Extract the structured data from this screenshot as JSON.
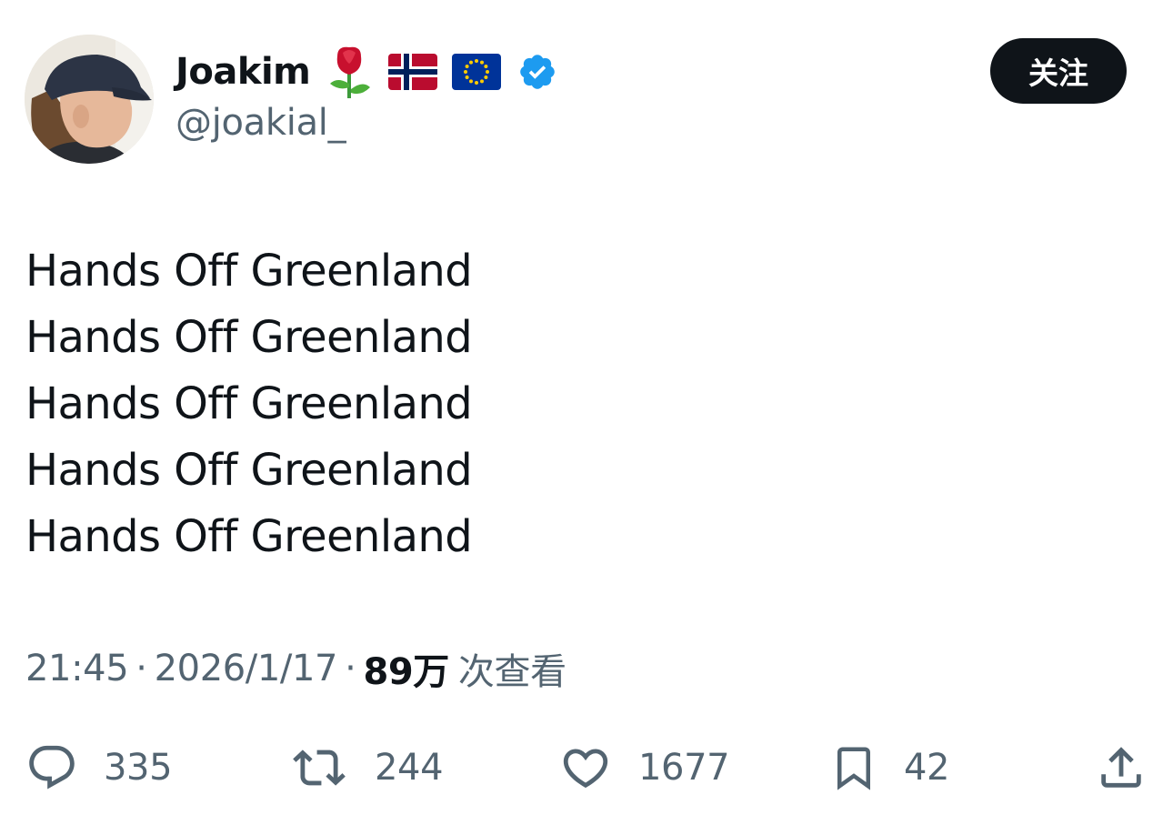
{
  "user": {
    "display_name": "Joakim",
    "handle": "@joakial_",
    "name_emojis": [
      "rose-emoji",
      "norway-flag-emoji",
      "eu-flag-emoji"
    ],
    "verified": true
  },
  "follow_button": {
    "label": "关注"
  },
  "tweet": {
    "lines": [
      "Hands Off Greenland",
      "Hands Off Greenland",
      "Hands Off Greenland",
      "Hands Off Greenland",
      "Hands Off Greenland"
    ]
  },
  "meta": {
    "time": "21:45",
    "separator": "·",
    "date": "2026/1/17",
    "views_count": "89万",
    "views_label": "次查看"
  },
  "actions": {
    "reply_count": "335",
    "retweet_count": "244",
    "like_count": "1677",
    "bookmark_count": "42"
  },
  "colors": {
    "text_primary": "#0f1419",
    "text_secondary": "#536471",
    "verified_blue": "#1d9bf0",
    "button_bg": "#0f1419"
  }
}
